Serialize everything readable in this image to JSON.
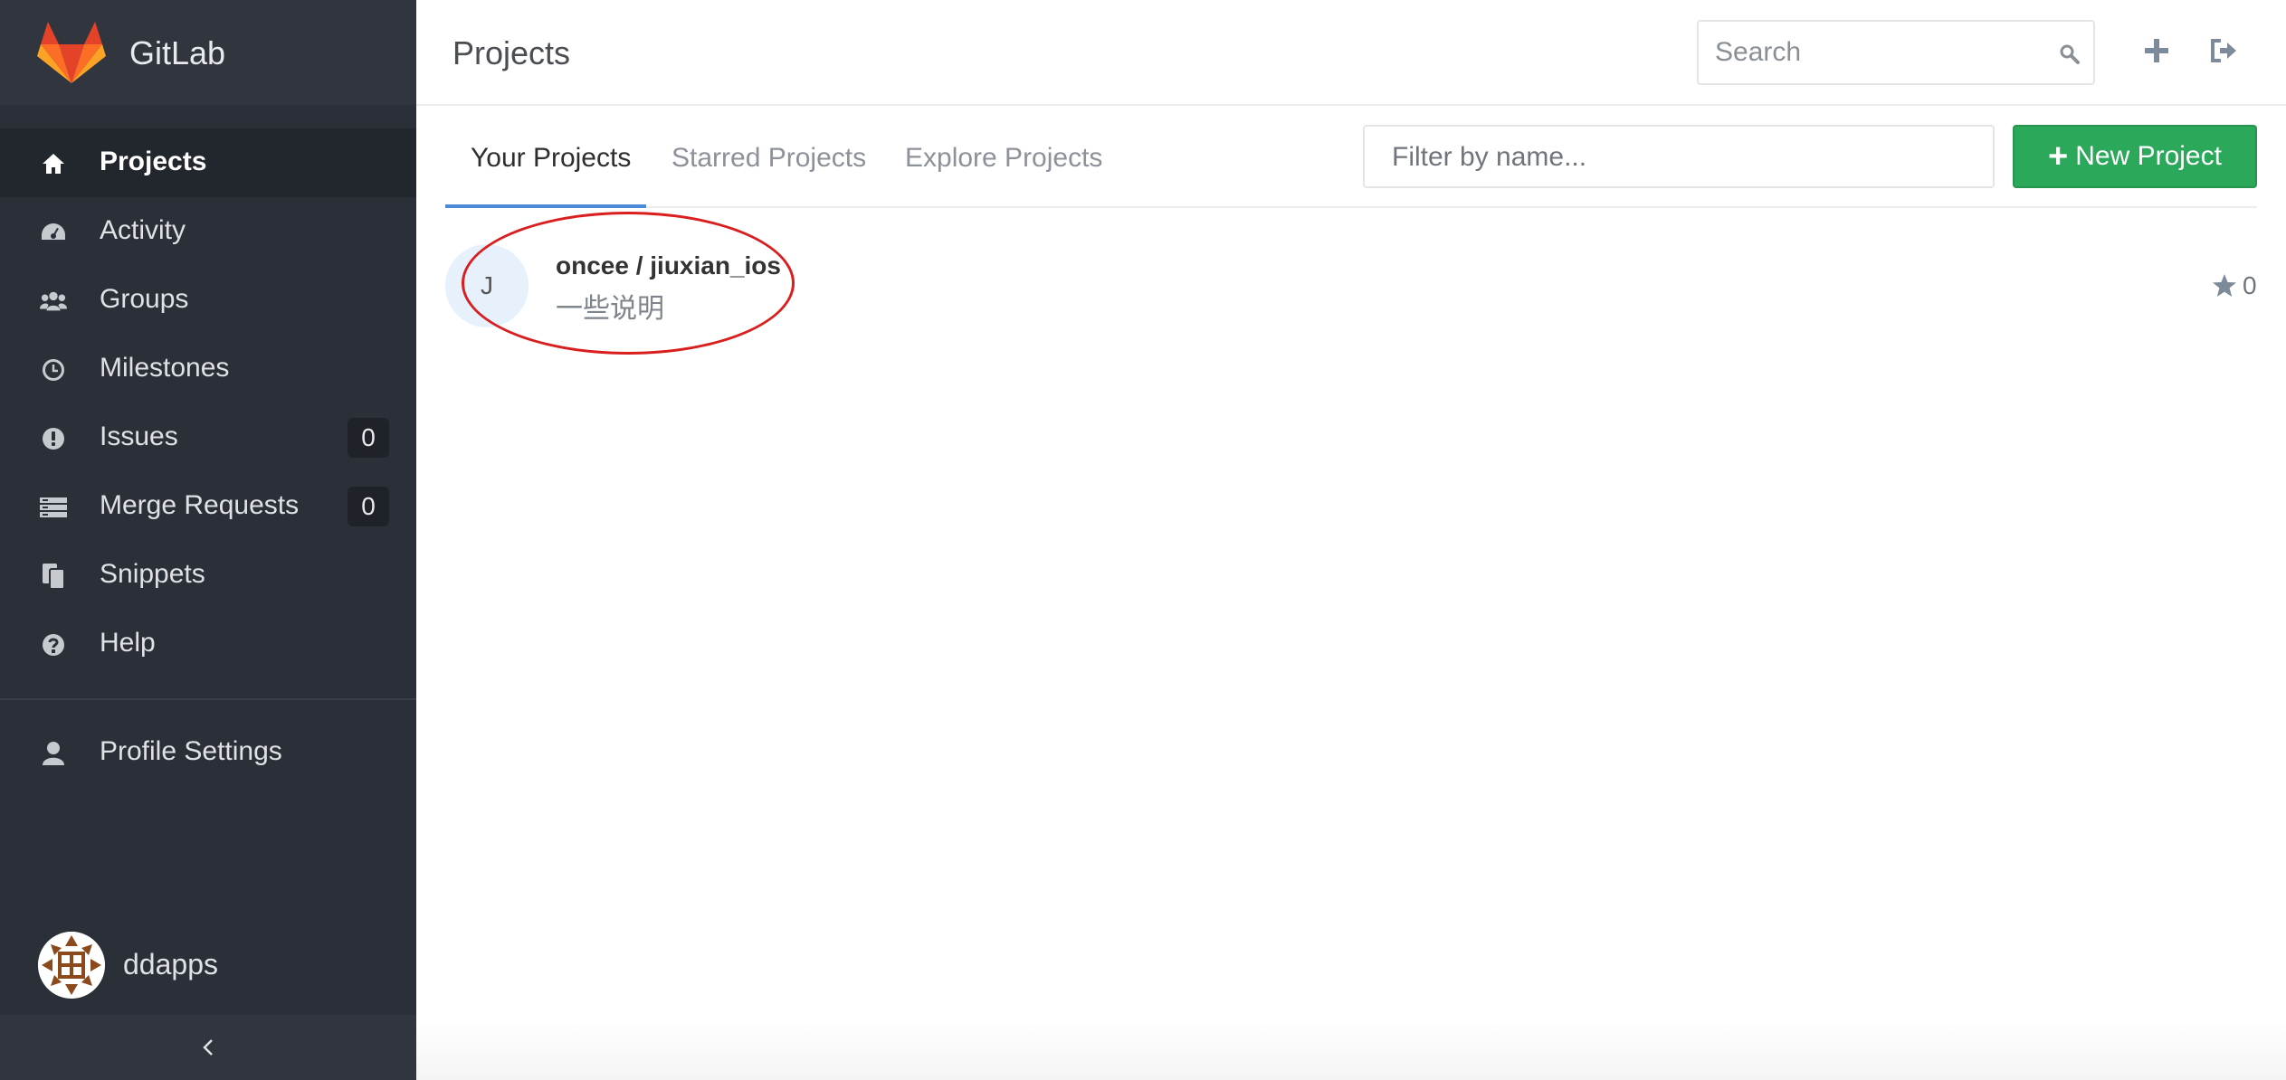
{
  "app": {
    "name": "GitLab"
  },
  "sidebar": {
    "items": [
      {
        "label": "Projects",
        "icon": "home-icon",
        "active": true
      },
      {
        "label": "Activity",
        "icon": "dashboard-icon"
      },
      {
        "label": "Groups",
        "icon": "users-icon"
      },
      {
        "label": "Milestones",
        "icon": "clock-icon"
      },
      {
        "label": "Issues",
        "icon": "exclamation-circle-icon",
        "count": "0"
      },
      {
        "label": "Merge Requests",
        "icon": "list-icon",
        "count": "0"
      },
      {
        "label": "Snippets",
        "icon": "clipboard-icon"
      },
      {
        "label": "Help",
        "icon": "question-circle-icon"
      }
    ],
    "profile": {
      "label": "Profile Settings",
      "icon": "user-icon"
    },
    "user": {
      "name": "ddapps"
    }
  },
  "header": {
    "title": "Projects",
    "search_placeholder": "Search"
  },
  "tabs": [
    {
      "label": "Your Projects",
      "active": true
    },
    {
      "label": "Starred Projects"
    },
    {
      "label": "Explore Projects"
    }
  ],
  "filter": {
    "placeholder": "Filter by name..."
  },
  "new_project": {
    "label": "New Project"
  },
  "projects": [
    {
      "initial": "J",
      "name": "oncee / jiuxian_ios",
      "description": "一些说明",
      "stars": "0"
    }
  ],
  "colors": {
    "sidebar_bg": "#2b3038",
    "accent_green": "#2ca85b",
    "tab_underline": "#4a8ad8",
    "annotation_red": "#d81e1e"
  }
}
